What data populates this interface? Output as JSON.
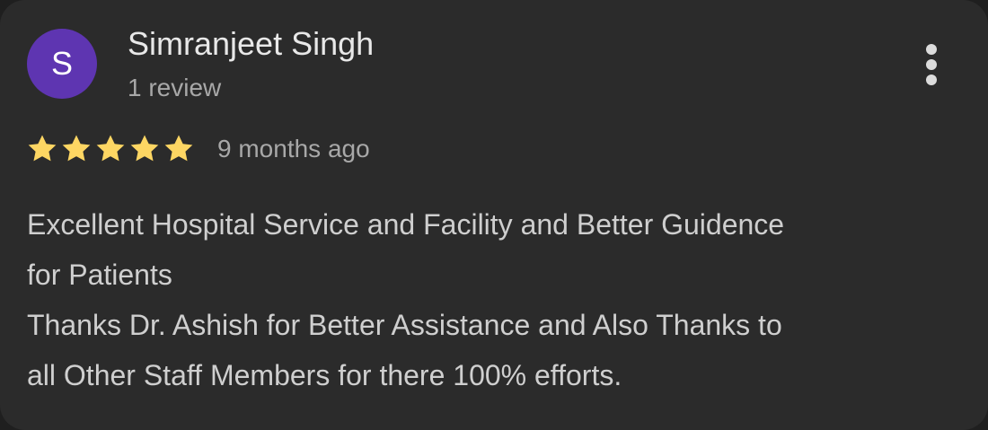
{
  "review": {
    "avatar_initial": "S",
    "avatar_color": "#5e35b1",
    "reviewer_name": "Simranjeet Singh",
    "review_count": "1 review",
    "rating": 5,
    "rating_max": 5,
    "star_color": "#fdd663",
    "time": "9 months ago",
    "more_icon": "more-vert-icon",
    "text_lines": [
      "Excellent Hospital Service and Facility and Better Guidence",
      "for Patients",
      "Thanks Dr. Ashish for Better Assistance and Also Thanks to",
      "all Other Staff Members for there 100% efforts."
    ]
  }
}
